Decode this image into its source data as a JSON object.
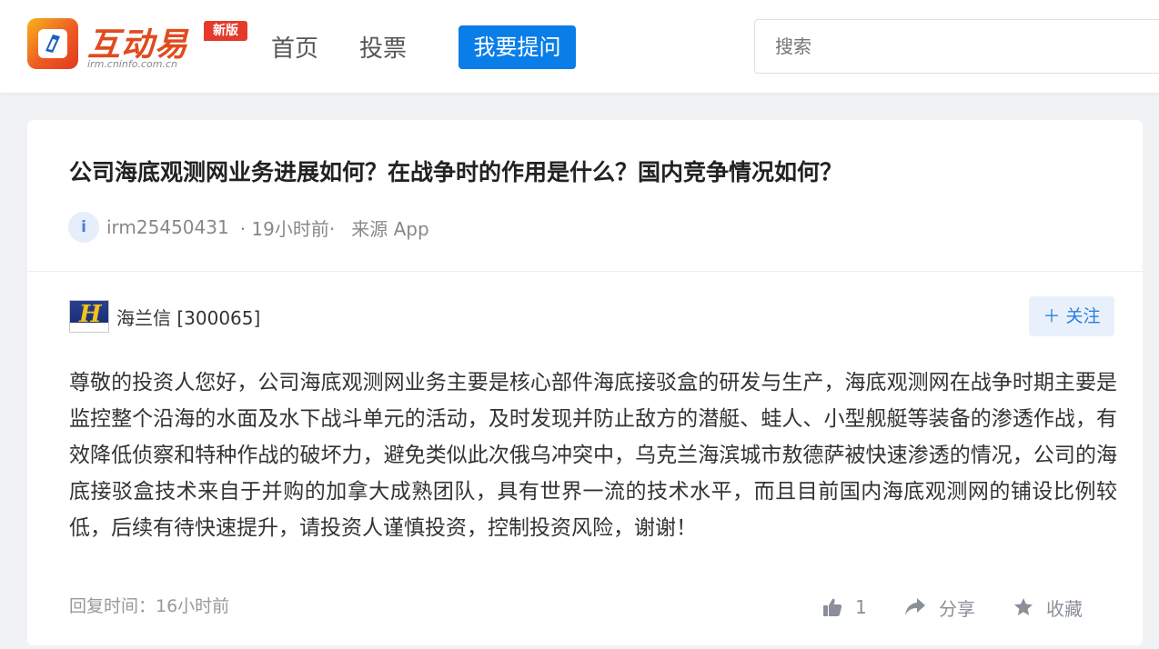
{
  "header": {
    "logo": {
      "name": "互动易",
      "badge": "新版",
      "url": "irm.cninfo.com.cn"
    },
    "nav": [
      {
        "label": "首页"
      },
      {
        "label": "投票"
      }
    ],
    "ask_button": "我要提问",
    "search": {
      "placeholder": "搜索",
      "value": ""
    }
  },
  "question": {
    "title": "公司海底观测网业务进展如何？在战争时的作用是什么？国内竞争情况如何？",
    "avatar_letter": "i",
    "user": "irm25450431",
    "time": "· 19小时前·",
    "source": "来源 App"
  },
  "answer": {
    "company": "海兰信 [300065]",
    "company_logo_letter": "H",
    "follow_label": "＋ 关注",
    "text": "尊敬的投资人您好，公司海底观测网业务主要是核心部件海底接驳盒的研发与生产，海底观测网在战争时期主要是监控整个沿海的水面及水下战斗单元的活动，及时发现并防止敌方的潜艇、蛙人、小型舰艇等装备的渗透作战，有效降低侦察和特种作战的破坏力，避免类似此次俄乌冲突中，乌克兰海滨城市敖德萨被快速渗透的情况，公司的海底接驳盒技术来自于并购的加拿大成熟团队，具有世界一流的技术水平，而且目前国内海底观测网的铺设比例较低，后续有待快速提升，请投资人谨慎投资，控制投资风险，谢谢！",
    "reply_time": "回复时间：16小时前",
    "like_count": "1",
    "share_label": "分享",
    "favorite_label": "收藏"
  },
  "colors": {
    "primary": "#0a7ee8",
    "brand": "#e04b1e",
    "badge": "#e53a2b"
  },
  "icons": [
    "logo-mark-icon",
    "thumbs-up-icon",
    "share-arrow-icon",
    "star-icon"
  ]
}
